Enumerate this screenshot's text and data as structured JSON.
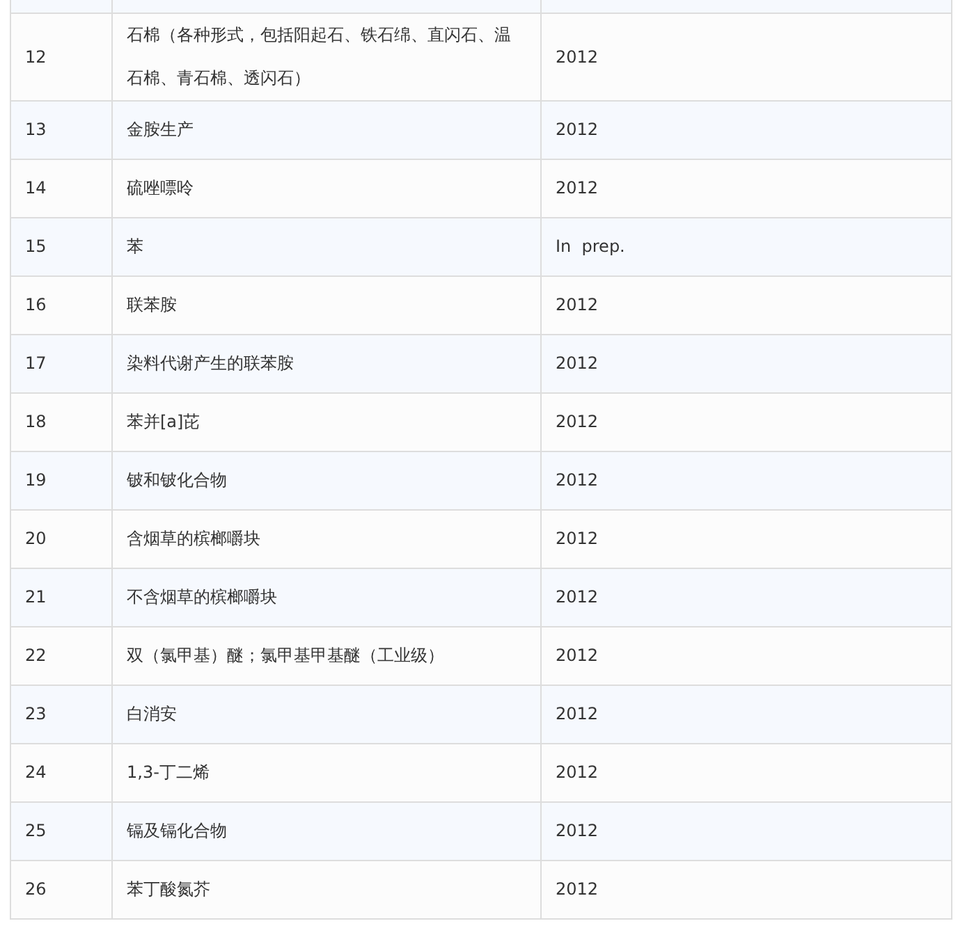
{
  "table": {
    "rows": [
      {
        "number": "12",
        "name": "石棉（各种形式，包括阳起石、铁石绵、直闪石、温石棉、青石棉、透闪石）",
        "year": "2012"
      },
      {
        "number": "13",
        "name": "金胺生产",
        "year": "2012"
      },
      {
        "number": "14",
        "name": "硫唑嘌呤",
        "year": "2012"
      },
      {
        "number": "15",
        "name": "苯",
        "year": "In  prep."
      },
      {
        "number": "16",
        "name": "联苯胺",
        "year": "2012"
      },
      {
        "number": "17",
        "name": "染料代谢产生的联苯胺",
        "year": "2012"
      },
      {
        "number": "18",
        "name": "苯并[a]芘",
        "year": "2012"
      },
      {
        "number": "19",
        "name": "铍和铍化合物",
        "year": "2012"
      },
      {
        "number": "20",
        "name": "含烟草的槟榔嚼块",
        "year": "2012"
      },
      {
        "number": "21",
        "name": "不含烟草的槟榔嚼块",
        "year": "2012"
      },
      {
        "number": "22",
        "name": "双（氯甲基）醚；氯甲基甲基醚（工业级）",
        "year": "2012"
      },
      {
        "number": "23",
        "name": "白消安",
        "year": "2012"
      },
      {
        "number": "24",
        "name": "1,3-丁二烯",
        "year": "2012"
      },
      {
        "number": "25",
        "name": "镉及镉化合物",
        "year": "2012"
      },
      {
        "number": "26",
        "name": "苯丁酸氮芥",
        "year": "2012"
      }
    ]
  }
}
